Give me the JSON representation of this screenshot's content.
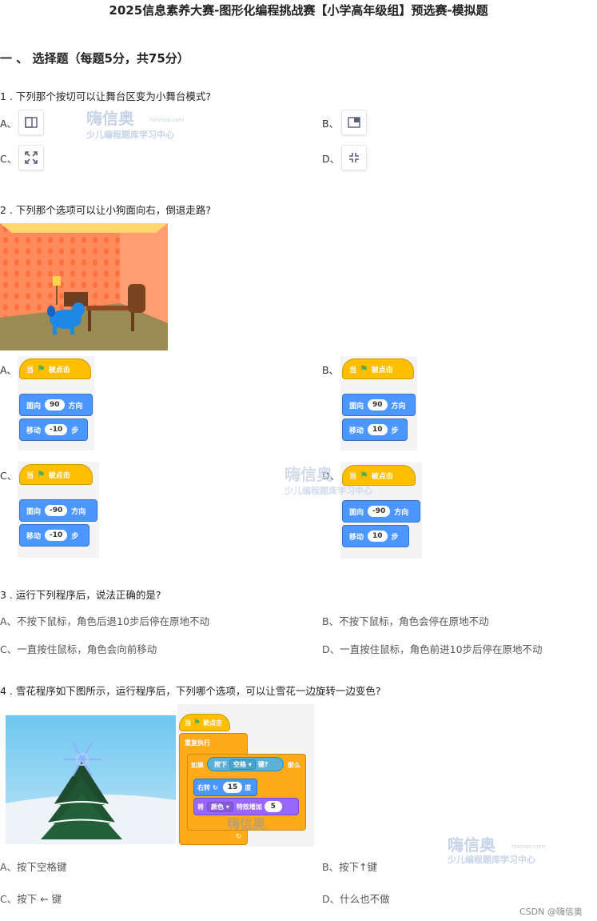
{
  "doc": {
    "title": "2025信息素养大赛-图形化编程挑战赛【小学高年级组】预选赛-模拟题",
    "section": "一 、 选择题（每题5分，共75分）"
  },
  "watermark": {
    "brand": "嗨信奥",
    "site": "hixinao.com",
    "slogan": "少儿编程题库学习中心"
  },
  "q1": {
    "stem": "1 . 下列那个按切可以让舞台区变为小舞台模式?",
    "options": [
      {
        "letter": "A、",
        "icon": "small-stage-mode-icon"
      },
      {
        "letter": "B、",
        "icon": "normal-stage-mode-icon"
      },
      {
        "letter": "C、",
        "icon": "fullscreen-icon"
      },
      {
        "letter": "D、",
        "icon": "exit-fullscreen-icon"
      }
    ]
  },
  "q2": {
    "stem": "2 . 下列那个选项可以让小狗面向右，倒退走路?",
    "options": [
      {
        "letter": "A、",
        "hat": "当",
        "hat_after": "被点击",
        "face_label": "面向",
        "face_val": "90",
        "face_unit": "方向",
        "move_label": "移动",
        "move_val": "-10",
        "move_unit": "步"
      },
      {
        "letter": "B、",
        "hat": "当",
        "hat_after": "被点击",
        "face_label": "面向",
        "face_val": "90",
        "face_unit": "方向",
        "move_label": "移动",
        "move_val": "10",
        "move_unit": "步"
      },
      {
        "letter": "C、",
        "hat": "当",
        "hat_after": "被点击",
        "face_label": "面向",
        "face_val": "-90",
        "face_unit": "方向",
        "move_label": "移动",
        "move_val": "-10",
        "move_unit": "步"
      },
      {
        "letter": "D、",
        "hat": "当",
        "hat_after": "被点击",
        "face_label": "面向",
        "face_val": "-90",
        "face_unit": "方向",
        "move_label": "移动",
        "move_val": "10",
        "move_unit": "步"
      }
    ]
  },
  "q3": {
    "stem": "3 . 运行下列程序后，说法正确的是?",
    "options": [
      "A、不按下鼠标，角色后退10步后停在原地不动",
      "B、不按下鼠标，角色会停在原地不动",
      "C、一直按住鼠标，角色会向前移动",
      "D、一直按住鼠标，角色前进10步后停在原地不动"
    ]
  },
  "q4": {
    "stem": "4 . 雪花程序如下图所示，运行程序后，下列哪个选项，可以让雪花一边旋转一边变色?",
    "code": {
      "hat": "当",
      "hat_after": "被点击",
      "forever": "重复执行",
      "if": "如果",
      "key_press": "按下",
      "key": "空格",
      "key_after": "键?",
      "then": "那么",
      "turn": "右转",
      "turn_val": "15",
      "turn_unit": "度",
      "set": "将",
      "effect": "颜色",
      "effect_op": "特效增加",
      "effect_val": "5"
    },
    "options": [
      "A、按下空格键",
      "B、按下↑键",
      "C、按下 ← 键",
      "D、什么也不做"
    ]
  },
  "footer": {
    "credit": "CSDN @嗨信奥"
  }
}
